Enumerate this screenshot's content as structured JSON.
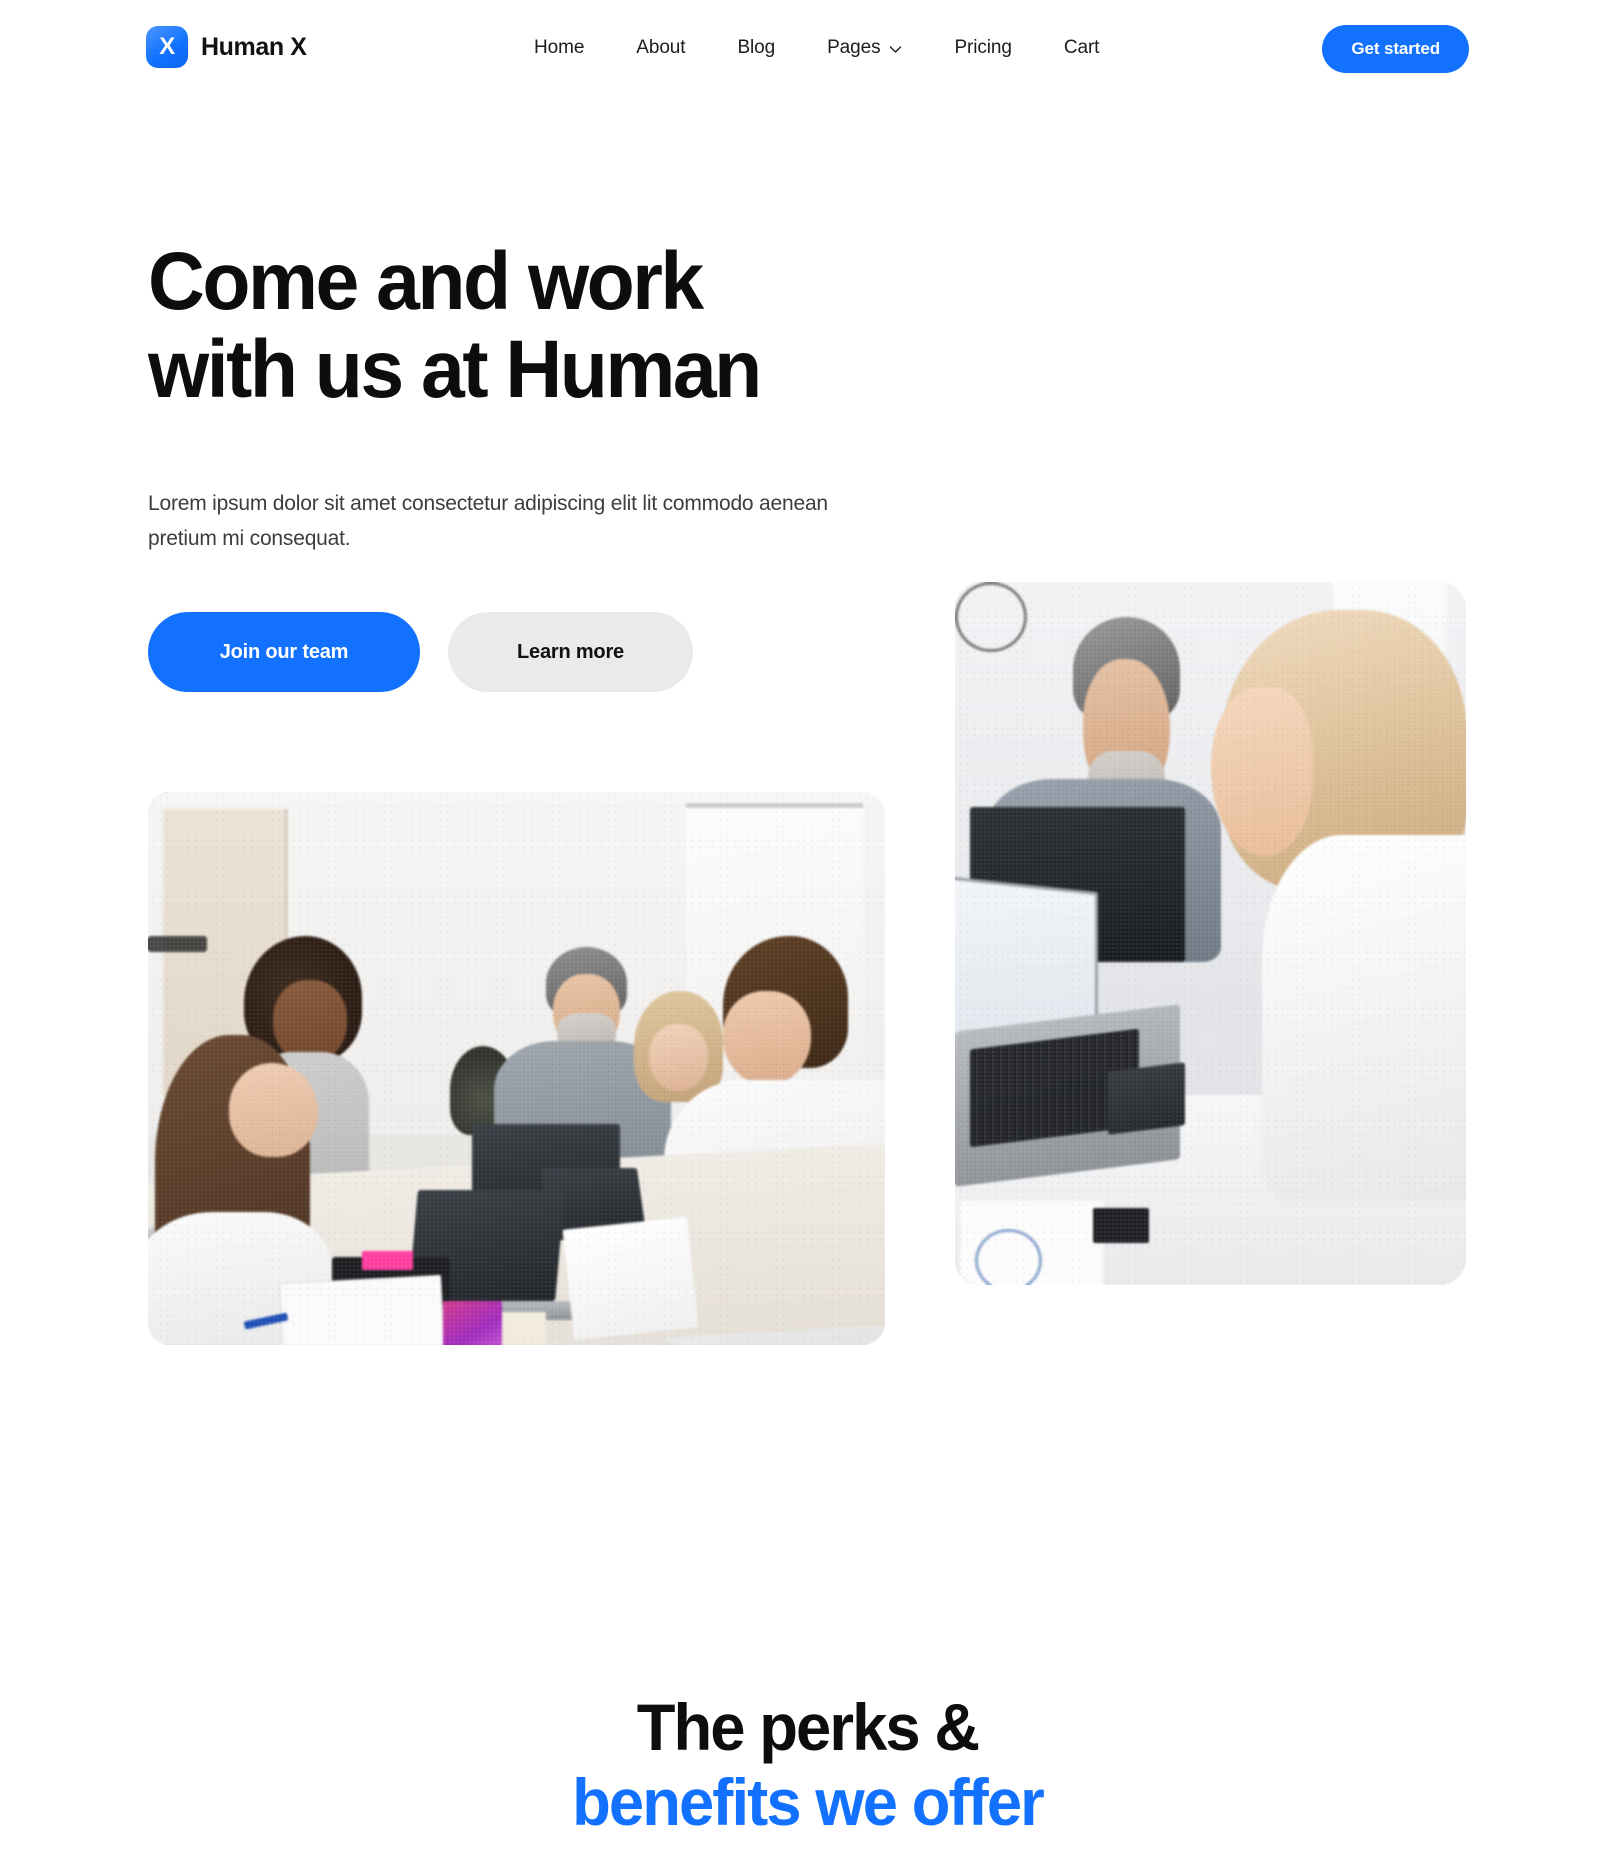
{
  "theme": {
    "accent": "#1271ff",
    "text_dark": "#0d0d0d",
    "text_body": "#3d3d3d",
    "button_secondary_bg": "#eaeaea",
    "page_bg": "#ffffff"
  },
  "header": {
    "logo_glyph": "X",
    "brand_name": "Human X",
    "nav": [
      {
        "label": "Home",
        "has_dropdown": false
      },
      {
        "label": "About",
        "has_dropdown": false
      },
      {
        "label": "Blog",
        "has_dropdown": false
      },
      {
        "label": "Pages",
        "has_dropdown": true
      },
      {
        "label": "Pricing",
        "has_dropdown": false
      },
      {
        "label": "Cart",
        "has_dropdown": false
      }
    ],
    "cta_label": "Get started"
  },
  "hero": {
    "title_line1": "Come and work",
    "title_line2": "with us at Human",
    "subtitle": "Lorem ipsum dolor sit amet consectetur adipiscing elit lit commodo aenean pretium mi consequat.",
    "primary_button": "Join our team",
    "secondary_button": "Learn more",
    "images": [
      {
        "name": "team-meeting-photo",
        "alt": "Team of five colleagues smiling around a conference table with laptops and documents"
      },
      {
        "name": "woman-at-desk-photo",
        "alt": "Blonde woman with glasses resting chin on hand beside an open laptop, colleague in background"
      }
    ]
  },
  "perks": {
    "title_line1": "The perks &",
    "title_line2": "benefits we offer"
  }
}
